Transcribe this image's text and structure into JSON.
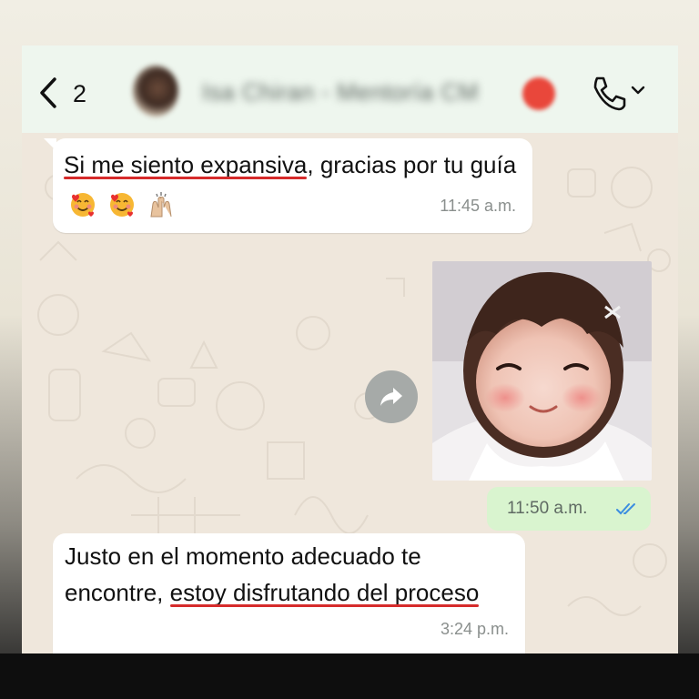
{
  "header": {
    "back_count": "2",
    "contact_name": "Isa Chiran - Mentoría CM"
  },
  "messages": [
    {
      "direction": "incoming",
      "segments": [
        {
          "text": "Si me siento expansiva",
          "underlined": true
        },
        {
          "text": ", gracias por tu guía",
          "underlined": false
        }
      ],
      "emojis": [
        "smiling-face-with-hearts-emoji",
        "smiling-face-with-hearts-emoji",
        "raising-hands-emoji"
      ],
      "time": "11:45 a.m."
    },
    {
      "direction": "outgoing",
      "type": "image",
      "image_description": "child-photo",
      "time": "11:50 a.m.",
      "status": "read"
    },
    {
      "direction": "incoming",
      "segments": [
        {
          "text": "Justo en el momento adecuado te encontre, ",
          "underlined": false
        },
        {
          "text": "estoy disfrutando del proceso",
          "underlined": true
        }
      ],
      "time": "3:24 p.m."
    }
  ],
  "colors": {
    "header_bg": "#eef6ee",
    "chat_bg": "#efe7dc",
    "incoming_bubble": "#ffffff",
    "outgoing_bubble": "#d9f4cf",
    "underline": "#d62b2b",
    "read_ticks": "#3b8de0"
  }
}
